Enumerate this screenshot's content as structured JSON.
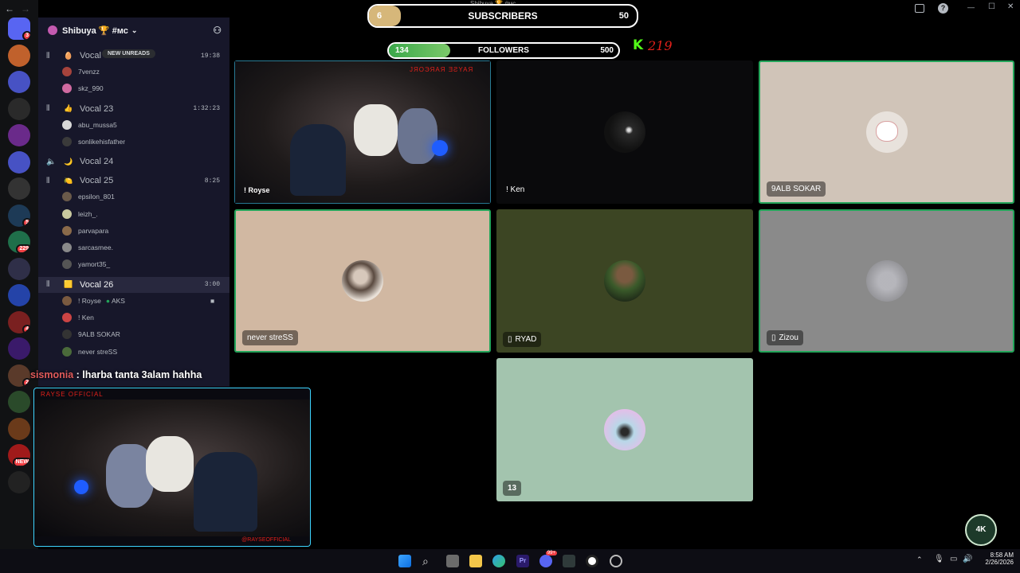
{
  "window": {
    "back_glyph": "←",
    "fwd_glyph": "→",
    "controls": {
      "minimize": "—",
      "maximize": "☐",
      "close": "✕"
    }
  },
  "rail": {
    "servers": [
      {
        "badge": "3",
        "color": "#5865f2"
      },
      {
        "badge": "",
        "color": "#c0612c"
      },
      {
        "badge": "",
        "color": "#4752c4"
      },
      {
        "badge": "",
        "color": "#2a2a2a"
      },
      {
        "badge": "",
        "color": "#6a2a8a"
      },
      {
        "badge": "",
        "color": "#4752c4"
      },
      {
        "badge": "",
        "color": "#333"
      },
      {
        "badge": "5",
        "color": "#1d3a56"
      },
      {
        "badge": "229",
        "color": "#1f6f4a"
      },
      {
        "badge": "",
        "color": "#2f2f48"
      },
      {
        "badge": "",
        "color": "#2443a8"
      },
      {
        "badge": "4",
        "color": "#7a2020"
      },
      {
        "badge": "",
        "color": "#3a1a6a"
      },
      {
        "badge": "2",
        "color": "#5a3a2a"
      },
      {
        "badge": "",
        "color": "#2a4a2a"
      },
      {
        "badge": "",
        "color": "#6a3a1a"
      },
      {
        "badge": "NEW",
        "color": "#a01a1a"
      },
      {
        "badge": "",
        "color": "#222"
      }
    ]
  },
  "channels": {
    "guild_name": "Shibuya 🏆 #мс",
    "new_unreads": "NEW UNREADS",
    "voice": [
      {
        "emoji": "🥚",
        "name": "Vocal",
        "time": "19:38",
        "users": [
          "7venzz",
          "skz_990"
        ]
      },
      {
        "emoji": "👍",
        "name": "Vocal 23",
        "time": "1:32:23",
        "users": [
          "abu_mussa5",
          "sonlikehisfather"
        ]
      },
      {
        "emoji": "🌙",
        "name": "Vocal 24",
        "time": "",
        "users": []
      },
      {
        "emoji": "🍋",
        "name": "Vocal 25",
        "time": "8:25",
        "users": [
          "epsilon_801",
          "leizh_.",
          "parvapara",
          "sarcasmee.",
          "yamort35_"
        ]
      },
      {
        "emoji": "🟨",
        "name": "Vocal 26",
        "time": "3:00",
        "users": [
          "! Royse",
          "! Ken",
          "9ALB SOKAR",
          "never streSS"
        ]
      }
    ],
    "royse_tag": "AKS"
  },
  "overlay": {
    "subscribers": {
      "left": "6",
      "label": "SUBSCRIBERS",
      "right": "50",
      "progress": 0.12
    },
    "followers": {
      "left": "134",
      "label": "FOLLOWERS",
      "right": "500",
      "progress": 0.268
    },
    "kick_count": "219",
    "small_title": "Shibuya 🏆 #мс",
    "chat": {
      "user": "sismonia",
      "sep": " : ",
      "msg": "lharba tanta 3alam hahha"
    },
    "cam_top_title": "ЈЯOЭЯAЯ ƎƧYAЯ",
    "cam_top_tag": "! Royse",
    "cam_bottom_title": "RAYSE OFFICIAL",
    "cam_bottom_handle": "@RAYSEOFFICIAL"
  },
  "tiles": [
    {
      "name": "! Ken",
      "bg": "#0a0a0c",
      "mobile": false
    },
    {
      "name": "9ALB SOKAR",
      "bg": "#d0c4b8",
      "mobile": false
    },
    {
      "name": "never streSS",
      "bg": "#d1b8a2",
      "mobile": false
    },
    {
      "name": "RYAD",
      "bg": "#3c4523",
      "mobile": true
    },
    {
      "name": "Zizou",
      "bg": "#8a8a8a",
      "mobile": true
    },
    {
      "name": "13",
      "bg": "#a3c4ae",
      "mobile": false
    }
  ],
  "taskbar": {
    "time": "8:58 AM",
    "date": "2/26/2026",
    "discord_badge": "99+",
    "logo_text": "4K"
  }
}
